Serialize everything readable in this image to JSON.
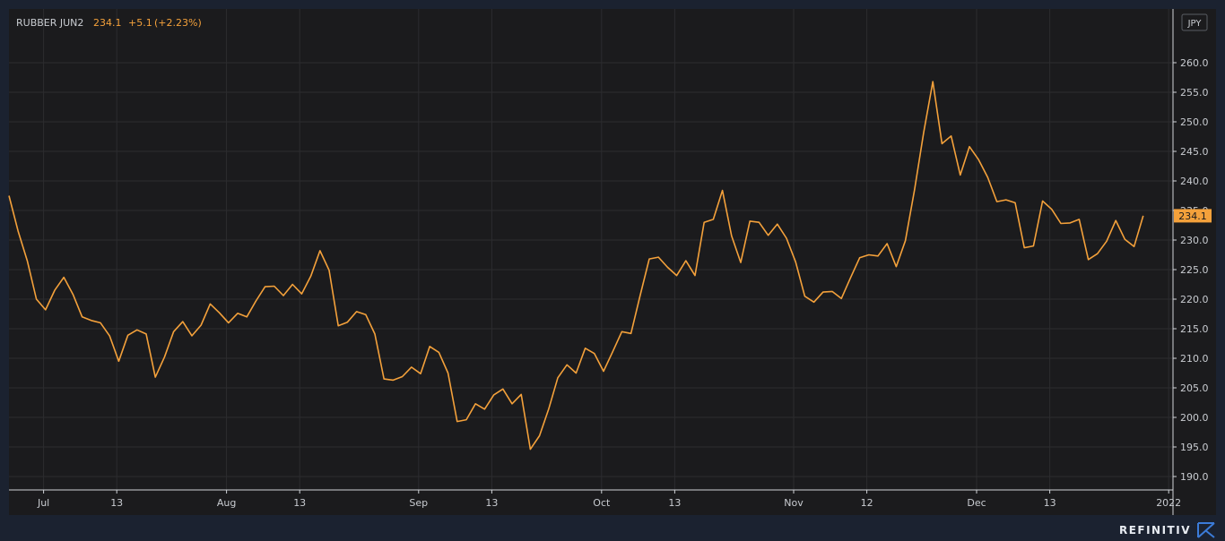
{
  "header": {
    "instrument": "RUBBER JUN2",
    "last": "234.1",
    "change": "+5.1",
    "change_pct": "(+2.23%)"
  },
  "currency_badge": "JPY",
  "last_price_label": "234.1",
  "brand": "REFINITIV",
  "colors": {
    "background": "#1b1b1d",
    "frame": "#1b2230",
    "line": "#f4a13b",
    "grid": "#2c2c2f",
    "text": "#c9ccd1"
  },
  "chart_data": {
    "type": "line",
    "title": "",
    "xlabel": "",
    "ylabel": "",
    "ylim": [
      188,
      268
    ],
    "y_ticks": [
      "190.0",
      "195.0",
      "200.0",
      "205.0",
      "210.0",
      "215.0",
      "220.0",
      "225.0",
      "230.0",
      "235.0",
      "240.0",
      "245.0",
      "250.0",
      "255.0",
      "260.0"
    ],
    "x_ticks": [
      {
        "label": "Jul",
        "index": 3
      },
      {
        "label": "13",
        "index": 11
      },
      {
        "label": "Aug",
        "index": 23
      },
      {
        "label": "13",
        "index": 31
      },
      {
        "label": "Sep",
        "index": 44
      },
      {
        "label": "13",
        "index": 52
      },
      {
        "label": "Oct",
        "index": 64
      },
      {
        "label": "13",
        "index": 72
      },
      {
        "label": "Nov",
        "index": 85
      },
      {
        "label": "12",
        "index": 93
      },
      {
        "label": "Dec",
        "index": 105
      },
      {
        "label": "13",
        "index": 113
      },
      {
        "label": "2022",
        "index": 126
      }
    ],
    "grid": true,
    "series": [
      {
        "values": [
          237.5,
          231.5,
          226.5,
          220.0,
          218.2,
          221.5,
          223.7,
          220.8,
          217.0,
          216.4,
          216.0,
          213.8,
          209.5,
          213.9,
          214.8,
          214.1,
          206.8,
          210.2,
          214.5,
          216.2,
          213.8,
          215.6,
          219.2,
          217.7,
          216.0,
          217.6,
          217.0,
          219.7,
          222.1,
          222.2,
          220.6,
          222.5,
          220.9,
          223.9,
          228.2,
          224.9,
          215.5,
          216.1,
          217.9,
          217.4,
          214.1,
          206.5,
          206.3,
          206.9,
          208.5,
          207.4,
          212.0,
          211.0,
          207.5,
          199.3,
          199.6,
          202.3,
          201.4,
          203.8,
          204.8,
          202.3,
          203.9,
          194.6,
          196.9,
          201.4,
          206.7,
          208.9,
          207.5,
          211.7,
          210.8,
          207.8,
          211.1,
          214.5,
          214.2,
          220.6,
          226.8,
          227.1,
          225.4,
          224.0,
          226.5,
          224.0,
          233.0,
          233.5,
          238.4,
          230.7,
          226.2,
          233.2,
          233.0,
          230.8,
          232.7,
          230.3,
          226.3,
          220.5,
          219.5,
          221.2,
          221.3,
          220.1,
          223.6,
          227.0,
          227.5,
          227.3,
          229.4,
          225.5,
          229.9,
          238.5,
          248.2,
          256.8,
          246.3,
          247.6,
          241.0,
          245.8,
          243.6,
          240.6,
          236.5,
          236.8,
          236.3,
          228.7,
          229.0,
          236.6,
          235.2,
          232.8,
          232.9,
          233.5,
          226.7,
          227.7,
          229.8,
          233.3,
          230.1,
          228.9,
          234.1
        ]
      }
    ]
  }
}
